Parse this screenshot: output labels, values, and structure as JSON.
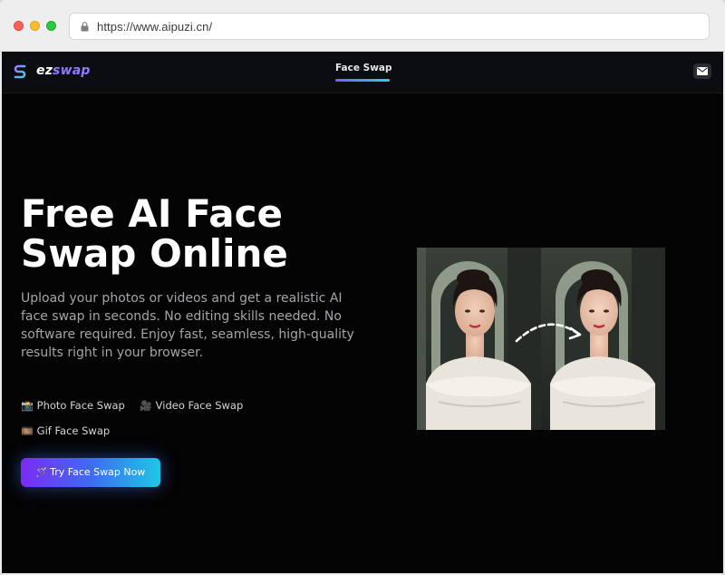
{
  "browser": {
    "url": "https://www.aipuzi.cn/"
  },
  "site": {
    "logo": {
      "part1": "ez",
      "part2": "swap",
      "icon": "logo-s-icon"
    },
    "nav": {
      "active_tab": "Face Swap"
    },
    "header_icons": [
      "mail-icon"
    ],
    "colors": {
      "accent_purple": "#7b2cf5",
      "accent_cyan": "#1ec7e6",
      "background": "#040405"
    }
  },
  "hero": {
    "title": "Free AI Face Swap Online",
    "subtitle": "Upload your photos or videos and get a realistic AI face swap in seconds. No editing skills needed. No software required. Enjoy fast, seamless, high-quality results right in your browser.",
    "features": [
      {
        "emoji": "📸",
        "label": "Photo Face Swap"
      },
      {
        "emoji": "🎥",
        "label": "Video Face Swap"
      },
      {
        "emoji": "🎞️",
        "label": "Gif Face Swap"
      }
    ],
    "cta": {
      "emoji": "🪄",
      "label": "Try Face Swap Now"
    }
  }
}
